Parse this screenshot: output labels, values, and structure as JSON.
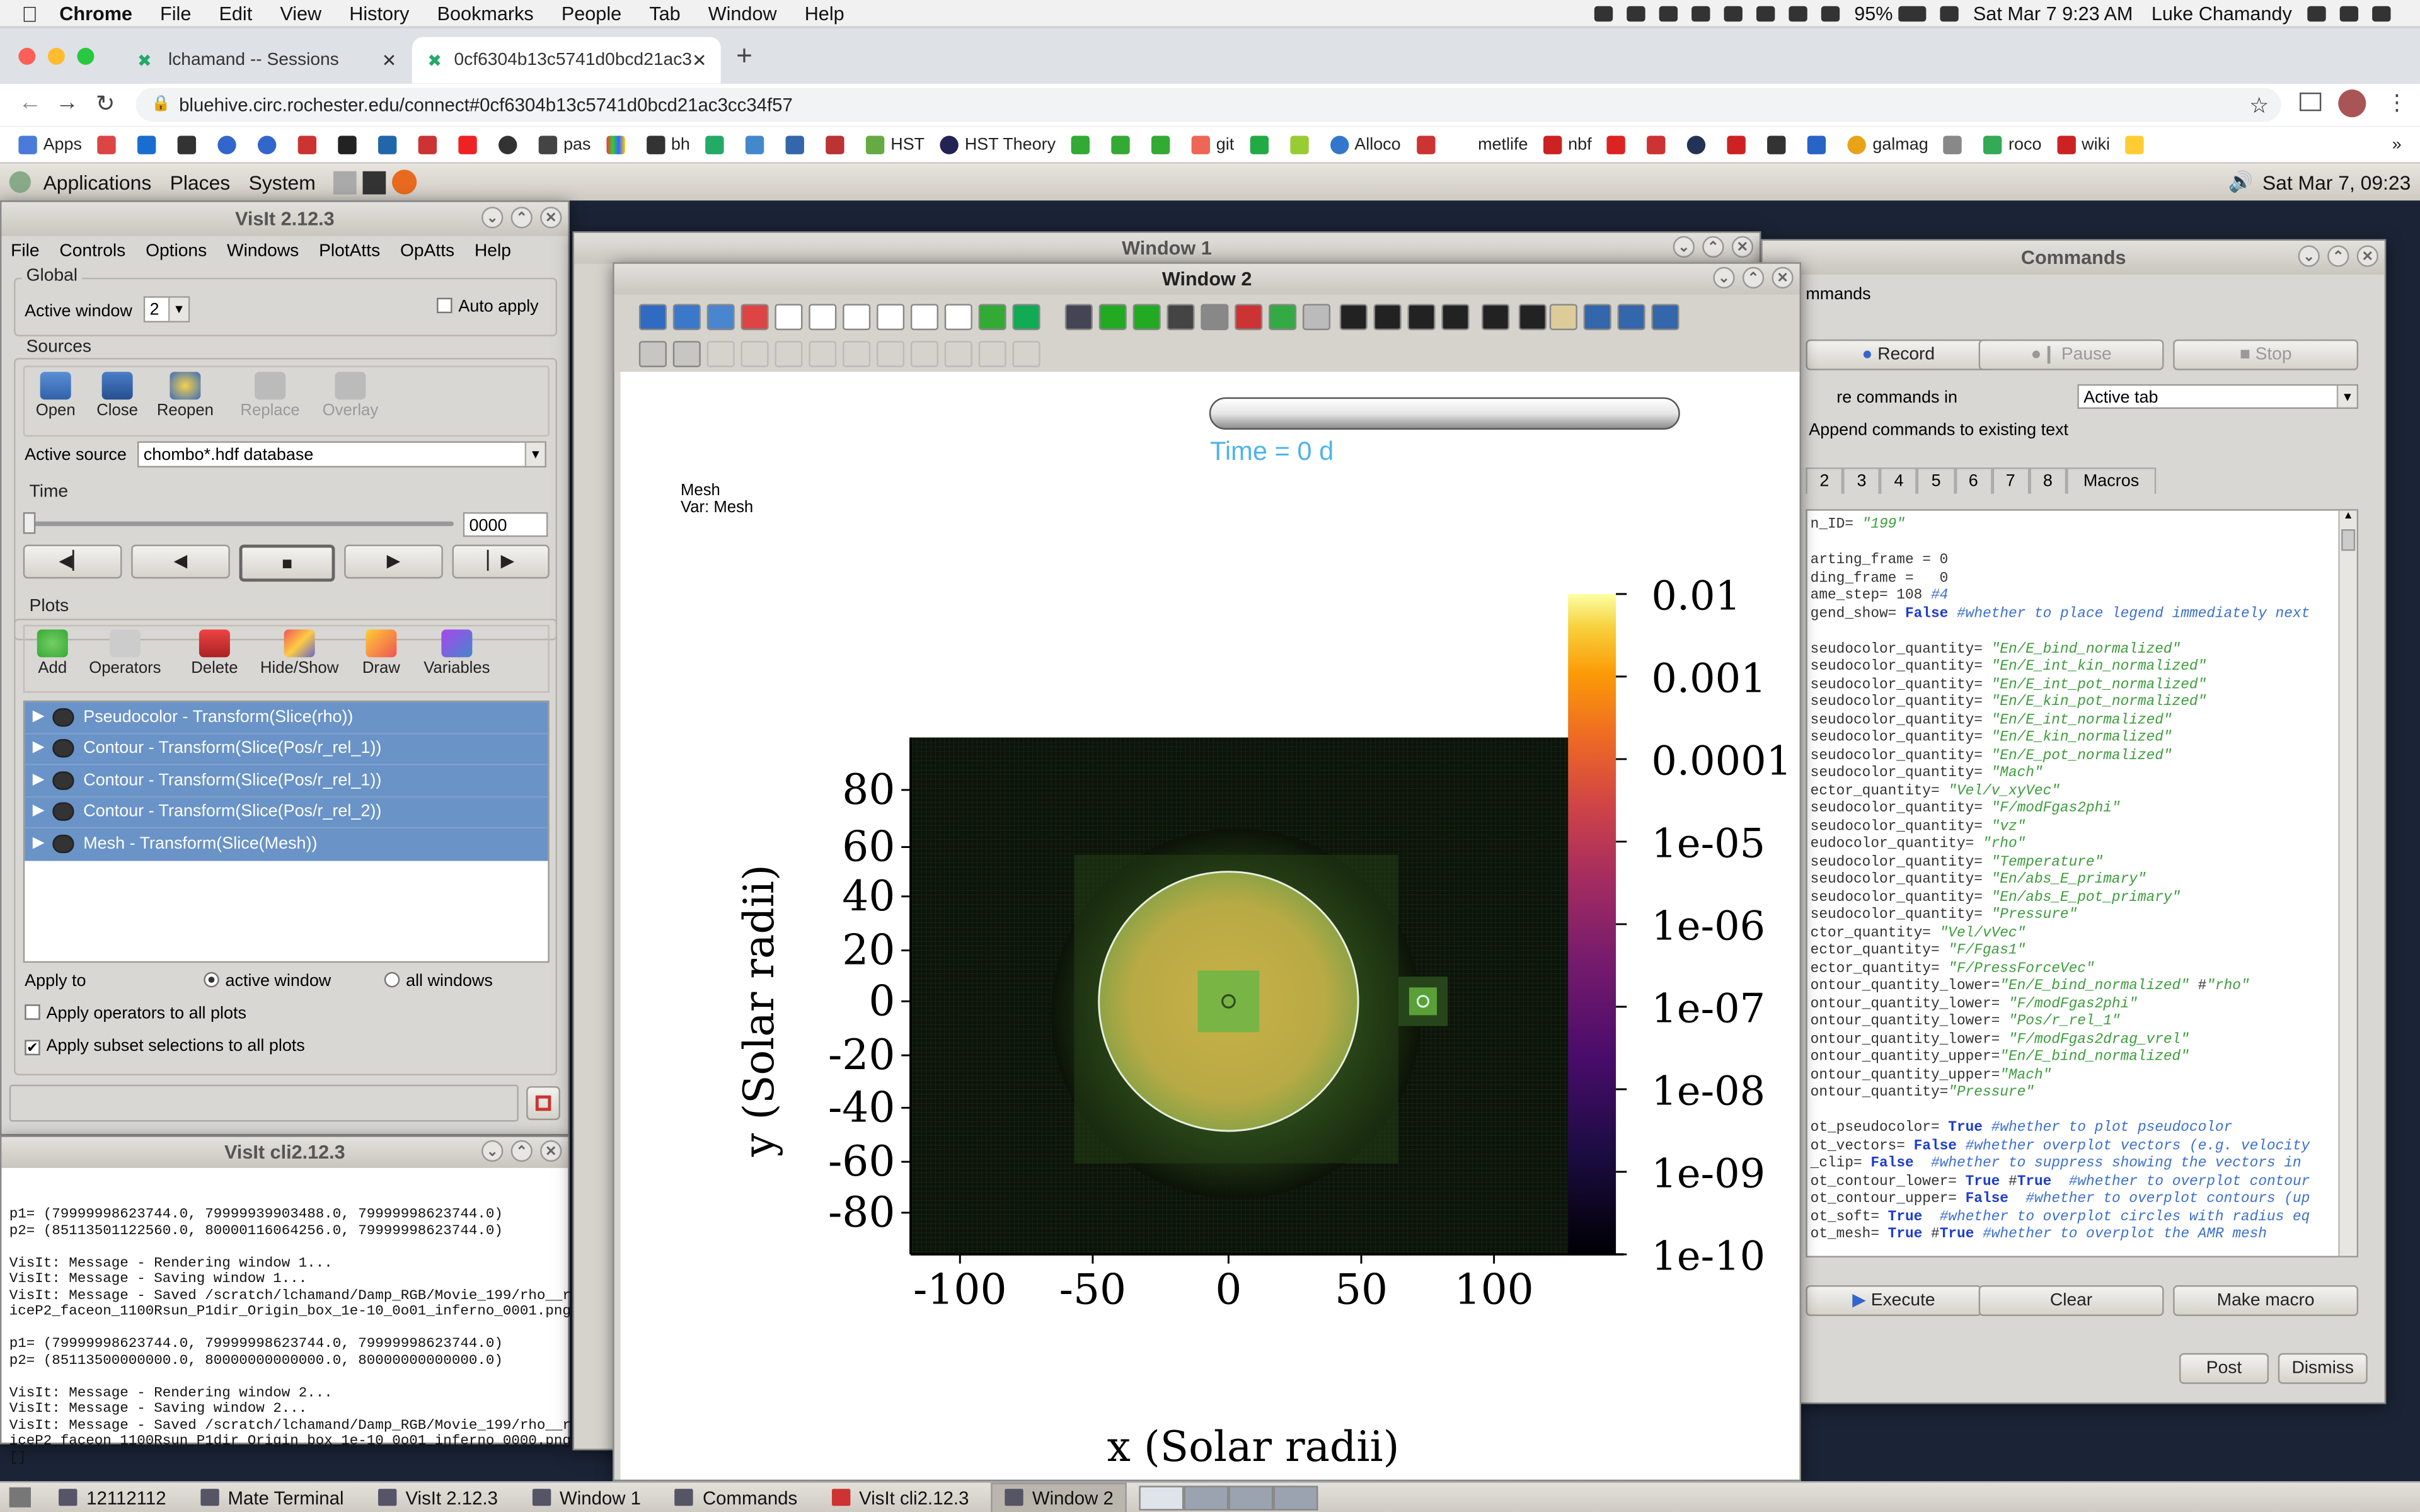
{
  "mac_menu": {
    "apple": "",
    "app": "Chrome",
    "items": [
      "File",
      "Edit",
      "View",
      "History",
      "Bookmarks",
      "People",
      "Tab",
      "Window",
      "Help"
    ],
    "battery": "95%",
    "datetime": "Sat Mar 7  9:23 AM",
    "user": "Luke Chamandy"
  },
  "chrome": {
    "tabs": [
      {
        "title": "lchamand -- Sessions",
        "active": false
      },
      {
        "title": "0cf6304b13c5741d0bcd21ac3",
        "active": true
      }
    ],
    "url": "bluehive.circ.rochester.edu/connect#0cf6304b13c5741d0bcd21ac3cc34f57",
    "bookmarks": [
      "Apps",
      "",
      "",
      "",
      "",
      "",
      "",
      "",
      "",
      "",
      "",
      "pas",
      "",
      "bh",
      "",
      "",
      "",
      "",
      "HST",
      "HST Theory",
      "",
      "",
      "",
      "git",
      "",
      "",
      "Alloco",
      "",
      "metlife",
      "nbf",
      "",
      "",
      "",
      "",
      "",
      "",
      "",
      "galmag",
      "",
      "roco",
      "wiki",
      ""
    ],
    "bookmark_overflow": "»"
  },
  "mate": {
    "menus": [
      "Applications",
      "Places",
      "System"
    ],
    "clock": "Sat Mar  7, 09:23"
  },
  "visit": {
    "title": "VisIt 2.12.3",
    "menus": [
      "File",
      "Controls",
      "Options",
      "Windows",
      "PlotAtts",
      "OpAtts",
      "Help"
    ],
    "global_label": "Global",
    "active_window_label": "Active window",
    "active_window_value": "2",
    "auto_apply": "Auto apply",
    "sources_label": "Sources",
    "source_buttons": [
      "Open",
      "Close",
      "Reopen",
      "Replace",
      "Overlay"
    ],
    "active_source_label": "Active source",
    "active_source_value": "chombo*.hdf database",
    "time_label": "Time",
    "time_value": "0000",
    "plots_label": "Plots",
    "plot_buttons": [
      "Add",
      "Operators",
      "Delete",
      "Hide/Show",
      "Draw",
      "Variables"
    ],
    "plots": [
      "Pseudocolor - Transform(Slice(rho))",
      "Contour - Transform(Slice(Pos/r_rel_1))",
      "Contour - Transform(Slice(Pos/r_rel_1))",
      "Contour - Transform(Slice(Pos/r_rel_2))",
      "Mesh - Transform(Slice(Mesh))"
    ],
    "apply_to": "Apply to",
    "active_window": "active window",
    "all_windows": "all windows",
    "apply_operators": "Apply operators to all plots",
    "apply_subset": "Apply subset selections to all plots"
  },
  "cli": {
    "title": "VisIt cli2.12.3",
    "lines": [
      "p1= (79999998623744.0, 79999939903488.0, 79999998623744.0)",
      "p2= (85113501122560.0, 80000116064256.0, 79999998623744.0)",
      "",
      "VisIt: Message - Rendering window 1...",
      "VisIt: Message - Saving window 1...",
      "VisIt: Message - Saved /scratch/lchamand/Damp_RGB/Movie_199/rho__r_rel_1_s",
      "iceP2_faceon_1100Rsun_P1dir_Origin_box_1e-10_0o01_inferno_0001.png",
      "",
      "p1= (79999998623744.0, 79999998623744.0, 79999998623744.0)",
      "p2= (85113500000000.0, 80000000000000.0, 80000000000000.0)",
      "",
      "VisIt: Message - Rendering window 2...",
      "VisIt: Message - Saving window 2...",
      "VisIt: Message - Saved /scratch/lchamand/Damp_RGB/Movie_199/rho__r_rel_1_s",
      "iceP2_faceon_1100Rsun_P1dir_Origin_box_1e-10_0o01_inferno_0000.png",
      "[]"
    ]
  },
  "window1": {
    "title": "Window 1"
  },
  "window2": {
    "title": "Window 2",
    "time_text": "Time = 0 d",
    "mesh_label": "Mesh",
    "var_label": "Var: Mesh",
    "xlabel": "x (Solar radii)",
    "ylabel": "y (Solar radii)",
    "xticks": [
      "-100",
      "-50",
      "0",
      "50",
      "100"
    ],
    "yticks": [
      "80",
      "60",
      "40",
      "20",
      "0",
      "-20",
      "-40",
      "-60",
      "-80"
    ],
    "cbar_ticks": [
      "0.01",
      "0.001",
      "0.0001",
      "1e-05",
      "1e-06",
      "1e-07",
      "1e-08",
      "1e-09",
      "1e-10"
    ]
  },
  "commands": {
    "title": "Commands",
    "cut_label": "mmands",
    "record": "Record",
    "pause": "Pause",
    "stop": "Stop",
    "store_label": "re commands in",
    "store_value": "Active tab",
    "append": "Append commands to existing text",
    "tabs": [
      "2",
      "3",
      "4",
      "5",
      "6",
      "7",
      "8",
      "Macros"
    ],
    "code": [
      "n_ID= \"199\"",
      "",
      "arting_frame = 0",
      "ding_frame =   0",
      "ame_step= 108 #4",
      "gend_show= False #whether to place legend immediately next",
      "",
      "seudocolor_quantity= \"En/E_bind_normalized\"",
      "seudocolor_quantity= \"En/E_int_kin_normalized\"",
      "seudocolor_quantity= \"En/E_int_pot_normalized\"",
      "seudocolor_quantity= \"En/E_kin_pot_normalized\"",
      "seudocolor_quantity= \"En/E_int_normalized\"",
      "seudocolor_quantity= \"En/E_kin_normalized\"",
      "seudocolor_quantity= \"En/E_pot_normalized\"",
      "seudocolor_quantity= \"Mach\"",
      "ector_quantity= \"Vel/v_xyVec\"",
      "seudocolor_quantity= \"F/modFgas2phi\"",
      "seudocolor_quantity= \"vz\"",
      "eudocolor_quantity= \"rho\"",
      "seudocolor_quantity= \"Temperature\"",
      "seudocolor_quantity= \"En/abs_E_primary\"",
      "seudocolor_quantity= \"En/abs_E_pot_primary\"",
      "seudocolor_quantity= \"Pressure\"",
      "ctor_quantity= \"Vel/vVec\"",
      "ector_quantity= \"F/Fgas1\"",
      "ector_quantity= \"F/PressForceVec\"",
      "ontour_quantity_lower=\"En/E_bind_normalized\" #\"rho\"",
      "ontour_quantity_lower= \"F/modFgas2phi\"",
      "ontour_quantity_lower= \"Pos/r_rel_1\"",
      "ontour_quantity_lower= \"F/modFgas2drag_vrel\"",
      "ontour_quantity_upper=\"En/E_bind_normalized\"",
      "ontour_quantity_upper=\"Mach\"",
      "ontour_quantity=\"Pressure\"",
      "",
      "ot_pseudocolor= True #whether to plot pseudocolor",
      "ot_vectors= False #whether overplot vectors (e.g. velocity",
      "_clip= False  #whether to suppress showing the vectors in",
      "ot_contour_lower= True #True  #whether to overplot contour",
      "ot_contour_upper= False  #whether to overplot contours (up",
      "ot_soft= True  #whether to overplot circles with radius eq",
      "ot_mesh= True #True #whether to overplot the AMR mesh"
    ],
    "execute": "Execute",
    "clear": "Clear",
    "make_macro": "Make macro",
    "post": "Post",
    "dismiss": "Dismiss"
  },
  "taskbar": [
    "12112112",
    "Mate Terminal",
    "VisIt 2.12.3",
    "Window 1",
    "Commands",
    "VisIt cli2.12.3",
    "Window 2"
  ]
}
